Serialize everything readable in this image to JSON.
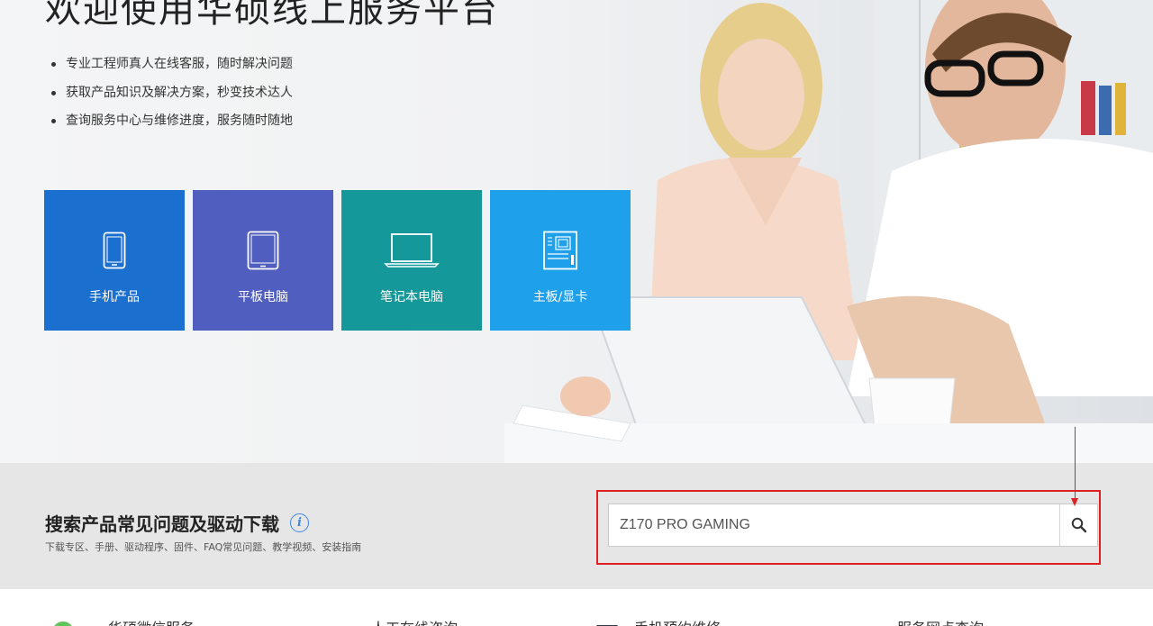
{
  "hero": {
    "title": "欢迎使用华硕线上服务平台",
    "bullets": [
      "专业工程师真人在线客服，随时解决问题",
      "获取产品知识及解决方案，秒变技术达人",
      "查询服务中心与维修进度，服务随时随地"
    ]
  },
  "tiles": [
    {
      "label": "手机产品",
      "icon": "smartphone-icon",
      "color": "#1a6fcf"
    },
    {
      "label": "平板电脑",
      "icon": "tablet-icon",
      "color": "#4f5ebf"
    },
    {
      "label": "笔记本电脑",
      "icon": "laptop-icon",
      "color": "#14989a"
    },
    {
      "label": "主板/显卡",
      "icon": "motherboard-icon",
      "color": "#1ea0ea"
    }
  ],
  "search_section": {
    "title": "搜索产品常见问题及驱动下载",
    "subtitle": "下载专区、手册、驱动程序、固件、FAQ常见问题、教学视频、安装指南",
    "input_value": "Z170 PRO GAMING",
    "highlight_color": "#e02020"
  },
  "bottom_row": {
    "items": [
      "华硕微信服务",
      "人工在线咨询",
      "手机预约维修",
      "服务网点查询"
    ]
  }
}
